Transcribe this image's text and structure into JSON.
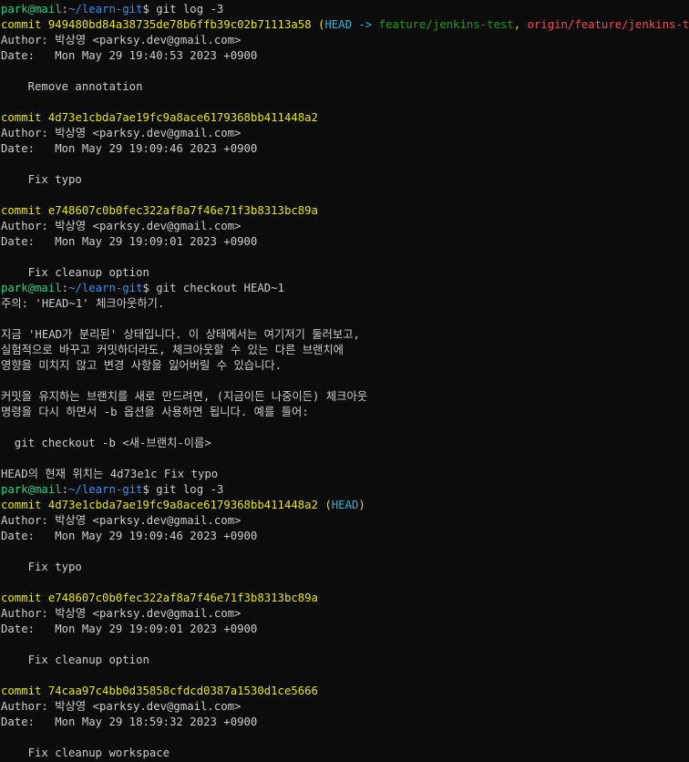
{
  "prompt": {
    "userhost": "park@mail",
    "sep": ":",
    "path": "~/learn-git",
    "symbol": "$"
  },
  "lines": [
    {
      "type": "prompt",
      "command": " git log -3"
    },
    {
      "type": "commit",
      "hash": "949480bd84a38735de78b6ffb39c02b71113a58",
      "refs": [
        {
          "text": "HEAD -> ",
          "c": "c"
        },
        {
          "text": "feature/jenkins-test",
          "c": "gr"
        },
        {
          "text": ", ",
          "c": "y"
        },
        {
          "text": "origin/feature/jenkins-test",
          "c": "r"
        }
      ]
    },
    {
      "type": "text",
      "text": "Author: 박상영 <parksy.dev@gmail.com>"
    },
    {
      "type": "text",
      "text": "Date:   Mon May 29 19:40:53 2023 +0900"
    },
    {
      "type": "text",
      "text": ""
    },
    {
      "type": "text",
      "text": "    Remove annotation"
    },
    {
      "type": "text",
      "text": ""
    },
    {
      "type": "commit",
      "hash": "4d73e1cbda7ae19fc9a8ace6179368bb411448a2",
      "refs": []
    },
    {
      "type": "text",
      "text": "Author: 박상영 <parksy.dev@gmail.com>"
    },
    {
      "type": "text",
      "text": "Date:   Mon May 29 19:09:46 2023 +0900"
    },
    {
      "type": "text",
      "text": ""
    },
    {
      "type": "text",
      "text": "    Fix typo"
    },
    {
      "type": "text",
      "text": ""
    },
    {
      "type": "commit",
      "hash": "e748607c0b0fec322af8a7f46e71f3b8313bc89a",
      "refs": []
    },
    {
      "type": "text",
      "text": "Author: 박상영 <parksy.dev@gmail.com>"
    },
    {
      "type": "text",
      "text": "Date:   Mon May 29 19:09:01 2023 +0900"
    },
    {
      "type": "text",
      "text": ""
    },
    {
      "type": "text",
      "text": "    Fix cleanup option"
    },
    {
      "type": "prompt",
      "command": " git checkout HEAD~1"
    },
    {
      "type": "text",
      "text": "주의: 'HEAD~1' 체크아웃하기."
    },
    {
      "type": "text",
      "text": ""
    },
    {
      "type": "text",
      "text": "지금 'HEAD가 분리된' 상태입니다. 이 상태에서는 여기저기 둘러보고,"
    },
    {
      "type": "text",
      "text": "실험적으로 바꾸고 커밋하더라도, 체크아웃할 수 있는 다른 브랜치에"
    },
    {
      "type": "text",
      "text": "영향을 미치지 않고 변경 사항을 잃어버릴 수 있습니다."
    },
    {
      "type": "text",
      "text": ""
    },
    {
      "type": "text",
      "text": "커밋을 유지하는 브랜치를 새로 만드려면, (지금이든 나중이든) 체크아웃"
    },
    {
      "type": "text",
      "text": "명령을 다시 하면서 -b 옵션을 사용하면 됩니다. 예를 들어:"
    },
    {
      "type": "text",
      "text": ""
    },
    {
      "type": "text",
      "text": "  git checkout -b <새-브랜치-이름>"
    },
    {
      "type": "text",
      "text": ""
    },
    {
      "type": "text",
      "text": "HEAD의 현재 위치는 4d73e1c Fix typo"
    },
    {
      "type": "prompt",
      "command": " git log -3"
    },
    {
      "type": "commit",
      "hash": "4d73e1cbda7ae19fc9a8ace6179368bb411448a2",
      "refs": [
        {
          "text": "HEAD",
          "c": "c"
        }
      ]
    },
    {
      "type": "text",
      "text": "Author: 박상영 <parksy.dev@gmail.com>"
    },
    {
      "type": "text",
      "text": "Date:   Mon May 29 19:09:46 2023 +0900"
    },
    {
      "type": "text",
      "text": ""
    },
    {
      "type": "text",
      "text": "    Fix typo"
    },
    {
      "type": "text",
      "text": ""
    },
    {
      "type": "commit",
      "hash": "e748607c0b0fec322af8a7f46e71f3b8313bc89a",
      "refs": []
    },
    {
      "type": "text",
      "text": "Author: 박상영 <parksy.dev@gmail.com>"
    },
    {
      "type": "text",
      "text": "Date:   Mon May 29 19:09:01 2023 +0900"
    },
    {
      "type": "text",
      "text": ""
    },
    {
      "type": "text",
      "text": "    Fix cleanup option"
    },
    {
      "type": "text",
      "text": ""
    },
    {
      "type": "commit",
      "hash": "74caa97c4bb0d35858cfdcd0387a1530d1ce5666",
      "refs": []
    },
    {
      "type": "text",
      "text": "Author: 박상영 <parksy.dev@gmail.com>"
    },
    {
      "type": "text",
      "text": "Date:   Mon May 29 18:59:32 2023 +0900"
    },
    {
      "type": "text",
      "text": ""
    },
    {
      "type": "text",
      "text": "    Fix cleanup workspace"
    }
  ]
}
